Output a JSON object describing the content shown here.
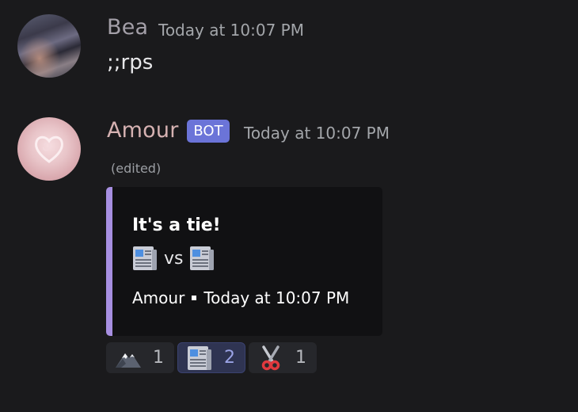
{
  "messages": [
    {
      "author": "Bea",
      "timestamp": "Today at 10:07 PM",
      "content": ";;rps"
    },
    {
      "author": "Amour",
      "bot_tag": "BOT",
      "timestamp": "Today at 10:07 PM",
      "edited": "(edited)",
      "embed": {
        "accent_color": "#a78fe1",
        "title": "It's a tie!",
        "vs_text": "vs",
        "left_emoji": "newspaper",
        "right_emoji": "newspaper",
        "footer_author": "Amour",
        "footer_time": "Today at 10:07 PM"
      },
      "reactions": [
        {
          "emoji": "mountain",
          "count": "1",
          "active": false
        },
        {
          "emoji": "newspaper",
          "count": "2",
          "active": true
        },
        {
          "emoji": "scissors",
          "count": "1",
          "active": false
        }
      ]
    }
  ],
  "colors": {
    "background": "#1a1a1c",
    "bot_tag": "#6b74d8",
    "embed_accent": "#a78fe1"
  }
}
